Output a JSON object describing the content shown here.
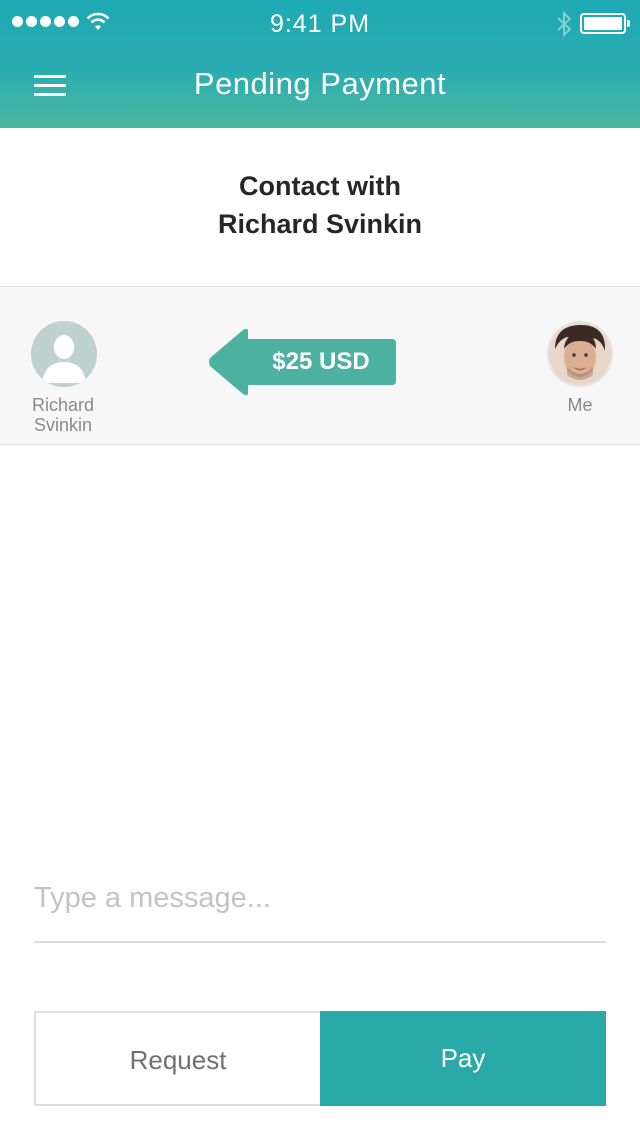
{
  "status_bar": {
    "time": "9:41 PM"
  },
  "header": {
    "title": "Pending Payment"
  },
  "contact": {
    "line1": "Contact with",
    "line2": "Richard Svinkin"
  },
  "transfer": {
    "from_name_line1": "Richard",
    "from_name_line2": "Svinkin",
    "to_name": "Me",
    "amount": "$25 USD",
    "arrow_color": "#4db1a1"
  },
  "message": {
    "placeholder": "Type a message..."
  },
  "actions": {
    "request_label": "Request",
    "pay_label": "Pay"
  },
  "colors": {
    "accent": "#29aaa8",
    "header_top": "#1fa9b4",
    "header_bottom": "#4cb7a1"
  }
}
